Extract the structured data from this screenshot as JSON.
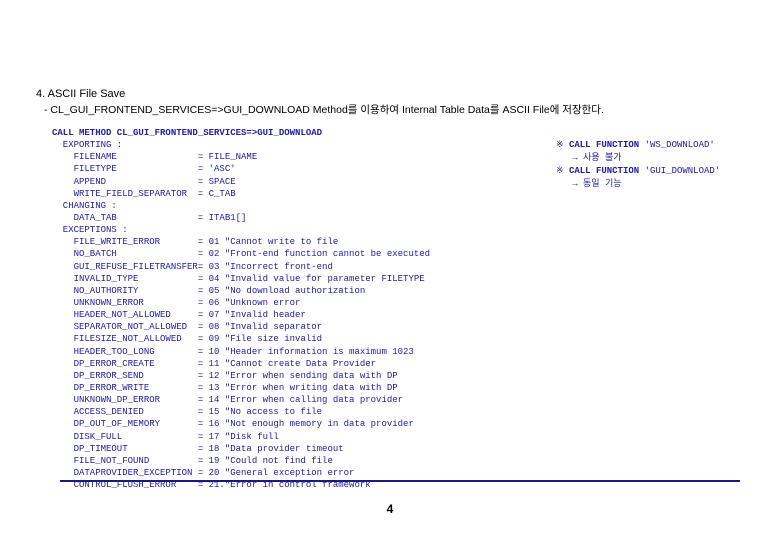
{
  "heading": "4. ASCII File Save",
  "subheading": "- CL_GUI_FRONTEND_SERVICES=>GUI_DOWNLOAD Method를 이용하여 Internal Table Data를 ASCII File에 저장한다.",
  "code": {
    "line1": "CALL METHOD CL_GUI_FRONTEND_SERVICES=>GUI_DOWNLOAD",
    "line2": "  EXPORTING :",
    "exporting": [
      {
        "name": "FILENAME",
        "val": "FILE_NAME"
      },
      {
        "name": "FILETYPE",
        "val": "'ASC'"
      },
      {
        "name": "APPEND",
        "val": "SPACE"
      },
      {
        "name": "WRITE_FIELD_SEPARATOR",
        "val": "C_TAB"
      }
    ],
    "line_changing": "  CHANGING :",
    "changing": [
      {
        "name": "DATA_TAB",
        "val": "ITAB1[]"
      }
    ],
    "line_exceptions": "  EXCEPTIONS :",
    "exceptions": [
      {
        "name": "FILE_WRITE_ERROR",
        "num": "01",
        "msg": "\"Cannot write to file"
      },
      {
        "name": "NO_BATCH",
        "num": "02",
        "msg": "\"Front-end function cannot be executed"
      },
      {
        "name": "GUI_REFUSE_FILETRANSFER",
        "num": "03",
        "msg": "\"Incorrect front-end"
      },
      {
        "name": "INVALID_TYPE",
        "num": "04",
        "msg": "\"Invalid value for parameter FILETYPE"
      },
      {
        "name": "NO_AUTHORITY",
        "num": "05",
        "msg": "\"No download authorization"
      },
      {
        "name": "UNKNOWN_ERROR",
        "num": "06",
        "msg": "\"Unknown error"
      },
      {
        "name": "HEADER_NOT_ALLOWED",
        "num": "07",
        "msg": "\"Invalid header"
      },
      {
        "name": "SEPARATOR_NOT_ALLOWED",
        "num": "08",
        "msg": "\"Invalid separator"
      },
      {
        "name": "FILESIZE_NOT_ALLOWED",
        "num": "09",
        "msg": "\"File size invalid"
      },
      {
        "name": "HEADER_TOO_LONG",
        "num": "10",
        "msg": "\"Header information is maximum 1023"
      },
      {
        "name": "DP_ERROR_CREATE",
        "num": "11",
        "msg": "\"Cannot create Data Provider"
      },
      {
        "name": "DP_ERROR_SEND",
        "num": "12",
        "msg": "\"Error when sending data with DP"
      },
      {
        "name": "DP_ERROR_WRITE",
        "num": "13",
        "msg": "\"Error when writing data with DP"
      },
      {
        "name": "UNKNOWN_DP_ERROR",
        "num": "14",
        "msg": "\"Error when calling data provider"
      },
      {
        "name": "ACCESS_DENIED",
        "num": "15",
        "msg": "\"No access to file"
      },
      {
        "name": "DP_OUT_OF_MEMORY",
        "num": "16",
        "msg": "\"Not enough memory in data provider"
      },
      {
        "name": "DISK_FULL",
        "num": "17",
        "msg": "\"Disk full"
      },
      {
        "name": "DP_TIMEOUT",
        "num": "18",
        "msg": "\"Data provider timeout"
      },
      {
        "name": "FILE_NOT_FOUND",
        "num": "19",
        "msg": "\"Could not find file"
      },
      {
        "name": "DATAPROVIDER_EXCEPTION",
        "num": "20",
        "msg": "\"General exception error"
      },
      {
        "name": "CONTROL_FLUSH_ERROR",
        "num": "21.",
        "msg": "\"Error in control framework"
      }
    ]
  },
  "sidenote": {
    "sym": "※",
    "call": "CALL FUNCTION",
    "fn1": "'WS_DOWNLOAD'",
    "arrow1": "→ 사용 불가",
    "fn2": "'GUI_DOWNLOAD'",
    "arrow2": "→ 동일 기능"
  },
  "pagenum": "4"
}
